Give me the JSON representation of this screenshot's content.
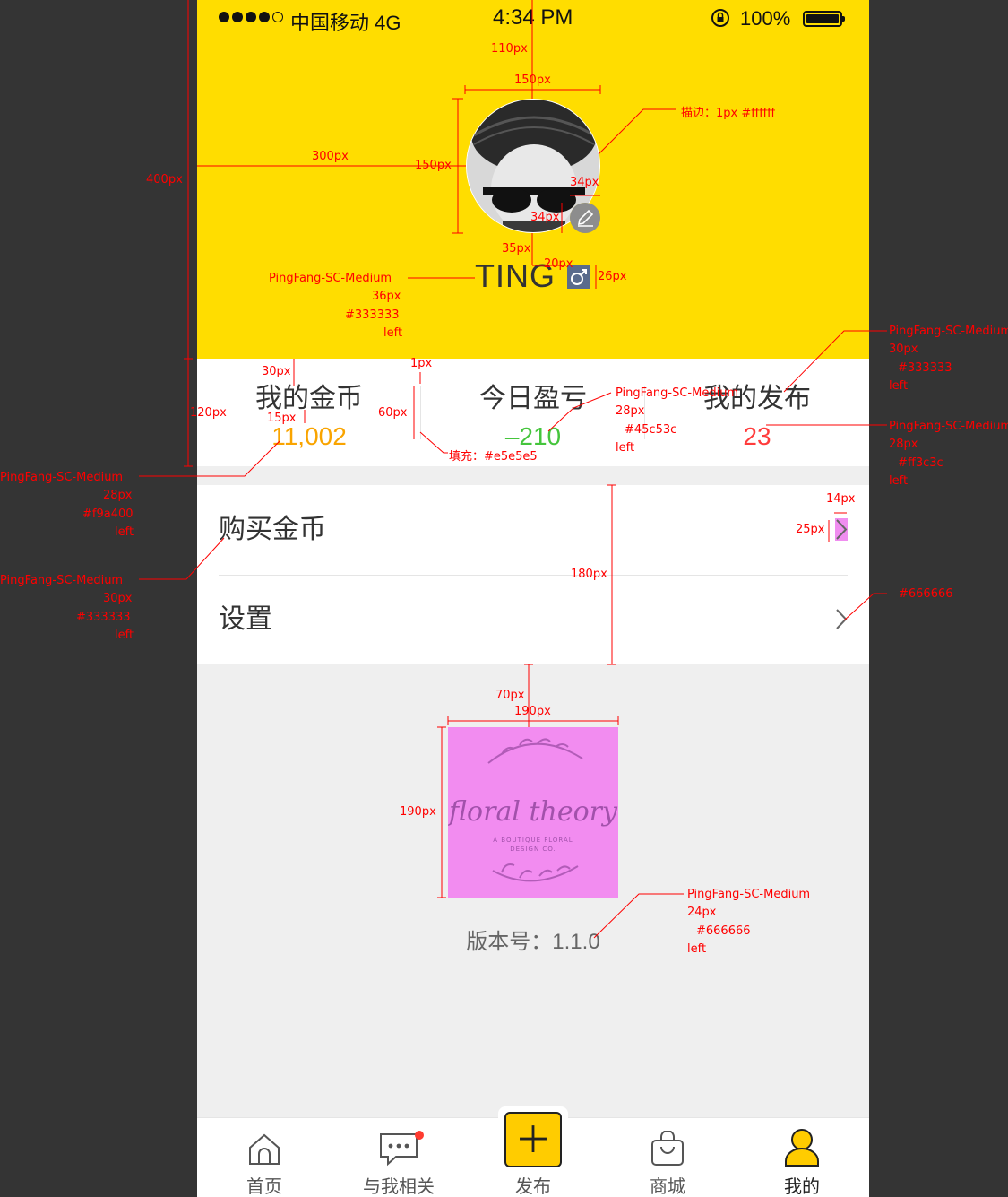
{
  "statusbar": {
    "carrier": "中国移动",
    "network": "4G",
    "time": "4:34 PM",
    "battery": "100%"
  },
  "profile": {
    "username": "TING"
  },
  "stats": [
    {
      "label": "我的金币",
      "value": "11,002",
      "color": "#f9a400"
    },
    {
      "label": "今日盈亏",
      "value": "–210",
      "color": "#45c53c"
    },
    {
      "label": "我的发布",
      "value": "23",
      "color": "#ff3c3c"
    }
  ],
  "menu": [
    {
      "label": "购买金币"
    },
    {
      "label": "设置"
    }
  ],
  "logo": {
    "script": "floral theory",
    "tagline1": "A BOUTIQUE FLORAL",
    "tagline2": "DESIGN CO."
  },
  "version": "版本号：1.1.0",
  "tabs": [
    {
      "label": "首页",
      "icon": "home-icon"
    },
    {
      "label": "与我相关",
      "icon": "message-icon"
    },
    {
      "label": "发布",
      "icon": "plus-icon"
    },
    {
      "label": "商城",
      "icon": "bag-icon"
    },
    {
      "label": "我的",
      "icon": "person-icon"
    }
  ],
  "colors": {
    "header": "#ffdd00",
    "accent": "#ffcc00",
    "text": "#333333",
    "divider": "#e5e5e5"
  },
  "annotations": {
    "h110": "110px",
    "w150": "150px",
    "stroke": "描边：1px #ffffff",
    "w300": "300px",
    "h150": "150px",
    "b34a": "34px",
    "b34b": "34px",
    "h35": "35px",
    "w20": "20px",
    "h26": "26px",
    "name_font": "PingFang-SC-Medium",
    "name_size": "36px",
    "name_color": "#333333",
    "name_align": "left",
    "h400": "400px",
    "h30": "30px",
    "w1": "1px",
    "h120": "120px",
    "h60": "60px",
    "h15": "15px",
    "fill": "填充：#e5e5e5",
    "lbl_font": "PingFang-SC-Medium",
    "lbl_size": "30px",
    "lbl_color": "#333333",
    "lbl_align": "left",
    "mid_font": "PingFang-SC-Medium",
    "mid_size": "28px",
    "mid_color": "#45c53c",
    "mid_align": "left",
    "red_font": "PingFang-SC-Medium",
    "red_size": "28px",
    "red_color": "#ff3c3c",
    "red_align": "left",
    "gold_font": "PingFang-SC-Medium",
    "gold_size": "28px",
    "gold_color": "#f9a400",
    "gold_align": "left",
    "menu_font": "PingFang-SC-Medium",
    "menu_size": "30px",
    "menu_color": "#333333",
    "menu_align": "left",
    "w14": "14px",
    "h25": "25px",
    "h180": "180px",
    "arrow_color": "#666666",
    "h70": "70px",
    "w190": "190px",
    "h190": "190px",
    "ver_font": "PingFang-SC-Medium",
    "ver_size": "24px",
    "ver_color": "#666666",
    "ver_align": "left"
  }
}
